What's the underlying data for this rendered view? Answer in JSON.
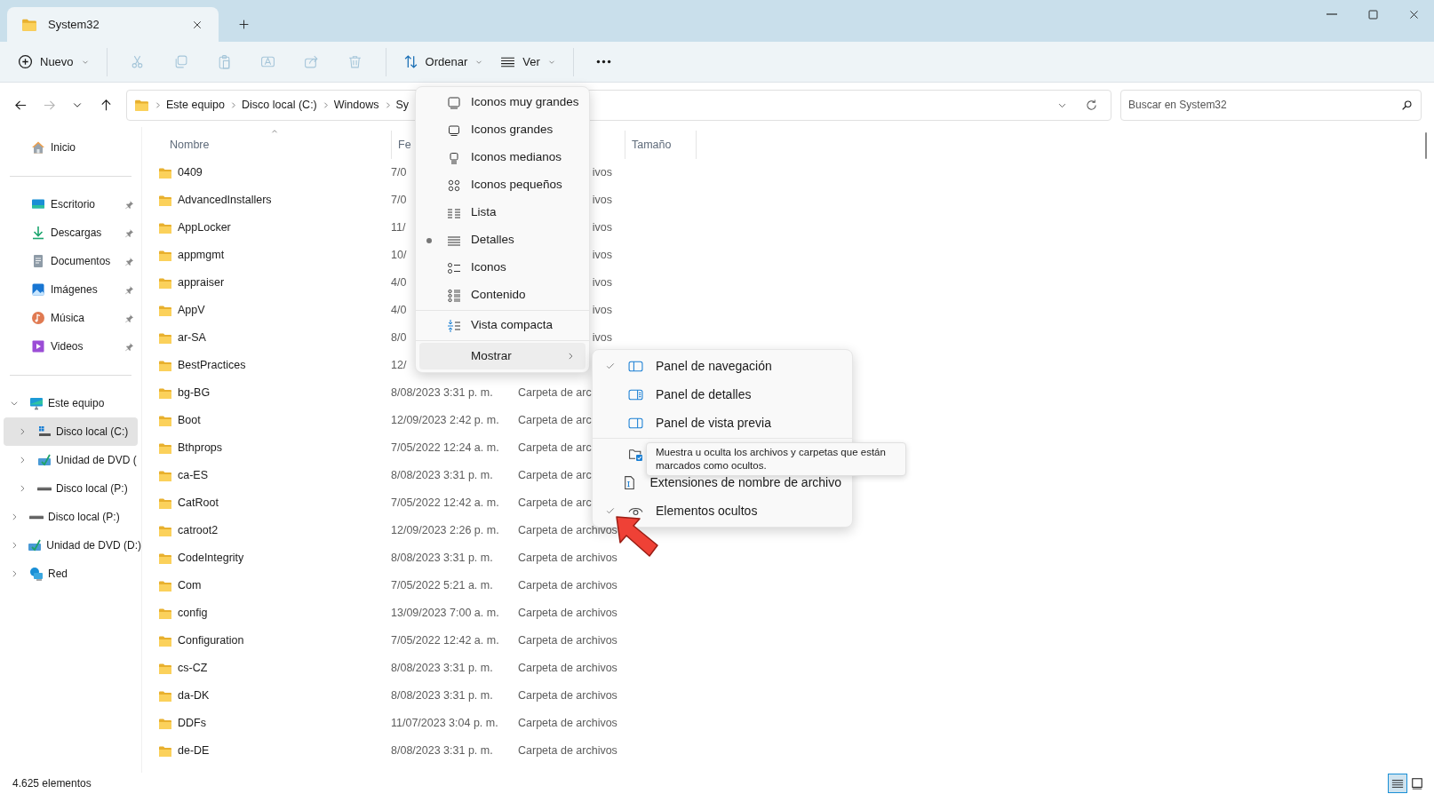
{
  "title_bar": {
    "tab": {
      "title": "System32",
      "selected": true
    }
  },
  "toolbar": [
    {
      "kind": "new",
      "label": "Nuevo",
      "disabled": false
    },
    {
      "kind": "separator"
    },
    {
      "kind": "cut",
      "disabled": true
    },
    {
      "kind": "copy",
      "disabled": true
    },
    {
      "kind": "paste",
      "disabled": true
    },
    {
      "kind": "rename",
      "disabled": true
    },
    {
      "kind": "share",
      "disabled": true
    },
    {
      "kind": "delete",
      "disabled": true
    },
    {
      "kind": "separator"
    },
    {
      "kind": "sort",
      "label": "Ordenar",
      "disabled": false
    },
    {
      "kind": "view",
      "label": "Ver",
      "disabled": false
    },
    {
      "kind": "separator"
    },
    {
      "kind": "more",
      "disabled": false
    }
  ],
  "navigation": {
    "back_disabled": false,
    "forward_disabled": true
  },
  "address": {
    "breadcrumbs": [
      "Este equipo",
      "Disco local (C:)",
      "Windows",
      "Sy"
    ]
  },
  "search": {
    "placeholder": "Buscar en System32"
  },
  "nav_pane": {
    "quick_access": [
      {
        "kind": "home",
        "label": "Inicio",
        "pinned": false
      },
      {
        "kind": "separator"
      },
      {
        "kind": "desktop",
        "label": "Escritorio",
        "pinned": true
      },
      {
        "kind": "downloads",
        "label": "Descargas",
        "pinned": true
      },
      {
        "kind": "documents",
        "label": "Documentos",
        "pinned": true
      },
      {
        "kind": "pictures",
        "label": "Imágenes",
        "pinned": true
      },
      {
        "kind": "music",
        "label": "Música",
        "pinned": true
      },
      {
        "kind": "videos",
        "label": "Videos",
        "pinned": true
      },
      {
        "kind": "separator"
      }
    ],
    "tree": [
      {
        "kind": "pc",
        "label": "Este equipo",
        "expanded": true,
        "selected": false,
        "children": [
          {
            "kind": "system-drive",
            "label": "Disco local (C:)",
            "expanded": false,
            "selected": true
          },
          {
            "kind": "dvd",
            "label": "Unidad de DVD (",
            "expanded": false,
            "selected": false
          },
          {
            "kind": "drive",
            "label": "Disco local (P:)",
            "expanded": false,
            "selected": false
          }
        ]
      },
      {
        "kind": "drive",
        "label": "Disco local (P:)",
        "expanded": false,
        "selected": false
      },
      {
        "kind": "dvd",
        "label": "Unidad de DVD (D:)",
        "expanded": false,
        "selected": false
      },
      {
        "kind": "network",
        "label": "Red",
        "expanded": false,
        "selected": false
      }
    ]
  },
  "table": {
    "columns": [
      {
        "label": "Nombre",
        "sorted": true
      },
      {
        "label": "Fe",
        "sorted": false
      },
      {
        "label": "Tamaño",
        "sorted": false
      }
    ],
    "rows": [
      {
        "name": "0409",
        "date": "7/0",
        "type": "ivos",
        "type_clipped_left": true
      },
      {
        "name": "AdvancedInstallers",
        "date": "7/0",
        "type": "ivos",
        "type_clipped_left": true
      },
      {
        "name": "AppLocker",
        "date": "11/",
        "type": "ivos",
        "type_clipped_left": true
      },
      {
        "name": "appmgmt",
        "date": "10/",
        "type": "ivos",
        "type_clipped_left": true
      },
      {
        "name": "appraiser",
        "date": "4/0",
        "type": "ivos",
        "type_clipped_left": true
      },
      {
        "name": "AppV",
        "date": "4/0",
        "type": "ivos",
        "type_clipped_left": true
      },
      {
        "name": "ar-SA",
        "date": "8/0",
        "type": "ivos",
        "type_clipped_left": true
      },
      {
        "name": "BestPractices",
        "date": "12/"
      },
      {
        "name": "bg-BG",
        "date": "8/08/2023 3:31 p. m.",
        "type": "Carpeta de arc"
      },
      {
        "name": "Boot",
        "date": "12/09/2023 2:42 p. m.",
        "type": "Carpeta de arc"
      },
      {
        "name": "Bthprops",
        "date": "7/05/2022 12:24 a. m.",
        "type": "Carpeta de arc"
      },
      {
        "name": "ca-ES",
        "date": "8/08/2023 3:31 p. m.",
        "type": "Carpeta de arc"
      },
      {
        "name": "CatRoot",
        "date": "7/05/2022 12:42 a. m.",
        "type": "Carpeta de arc"
      },
      {
        "name": "catroot2",
        "date": "12/09/2023 2:26 p. m.",
        "type": "Carpeta de archivos"
      },
      {
        "name": "CodeIntegrity",
        "date": "8/08/2023 3:31 p. m.",
        "type": "Carpeta de archivos"
      },
      {
        "name": "Com",
        "date": "7/05/2022 5:21 a. m.",
        "type": "Carpeta de archivos"
      },
      {
        "name": "config",
        "date": "13/09/2023 7:00 a. m.",
        "type": "Carpeta de archivos"
      },
      {
        "name": "Configuration",
        "date": "7/05/2022 12:42 a. m.",
        "type": "Carpeta de archivos"
      },
      {
        "name": "cs-CZ",
        "date": "8/08/2023 3:31 p. m.",
        "type": "Carpeta de archivos"
      },
      {
        "name": "da-DK",
        "date": "8/08/2023 3:31 p. m.",
        "type": "Carpeta de archivos"
      },
      {
        "name": "DDFs",
        "date": "11/07/2023 3:04 p. m.",
        "type": "Carpeta de archivos"
      },
      {
        "name": "de-DE",
        "date": "8/08/2023 3:31 p. m.",
        "type": "Carpeta de archivos"
      }
    ]
  },
  "view_menu": {
    "items": [
      {
        "kind": "xl-icons",
        "label": "Iconos muy grandes",
        "selected": false
      },
      {
        "kind": "large-icons",
        "label": "Iconos grandes",
        "selected": false
      },
      {
        "kind": "medium-icons",
        "label": "Iconos medianos",
        "selected": false
      },
      {
        "kind": "small-icons",
        "label": "Iconos pequeños",
        "selected": false
      },
      {
        "kind": "list",
        "label": "Lista",
        "selected": false
      },
      {
        "kind": "details",
        "label": "Detalles",
        "selected": true
      },
      {
        "kind": "tiles",
        "label": "Iconos",
        "selected": false
      },
      {
        "kind": "content",
        "label": "Contenido",
        "selected": false
      },
      {
        "kind": "separator"
      },
      {
        "kind": "compact",
        "label": "Vista compacta",
        "checked": false
      },
      {
        "kind": "separator"
      },
      {
        "kind": "submenu",
        "label": "Mostrar",
        "expanded": true
      }
    ]
  },
  "show_submenu": {
    "items": [
      {
        "kind": "nav-pane",
        "label": "Panel de navegación",
        "checked": true
      },
      {
        "kind": "details-pane",
        "label": "Panel de detalles",
        "checked": false
      },
      {
        "kind": "preview-pane",
        "label": "Panel de vista previa",
        "checked": false
      },
      {
        "kind": "separator"
      },
      {
        "kind": "item-checkboxes"
      },
      {
        "kind": "extensions",
        "label": "Extensiones de nombre de archivo",
        "checked": false
      },
      {
        "kind": "hidden-items",
        "label": "Elementos ocultos",
        "checked": true
      }
    ]
  },
  "tooltip": {
    "text": "Muestra u oculta los archivos y carpetas que están marcados como ocultos."
  },
  "status_bar": {
    "count": "4.625 elementos",
    "views": [
      {
        "kind": "details",
        "selected": true
      },
      {
        "kind": "tiles",
        "selected": false
      }
    ]
  }
}
